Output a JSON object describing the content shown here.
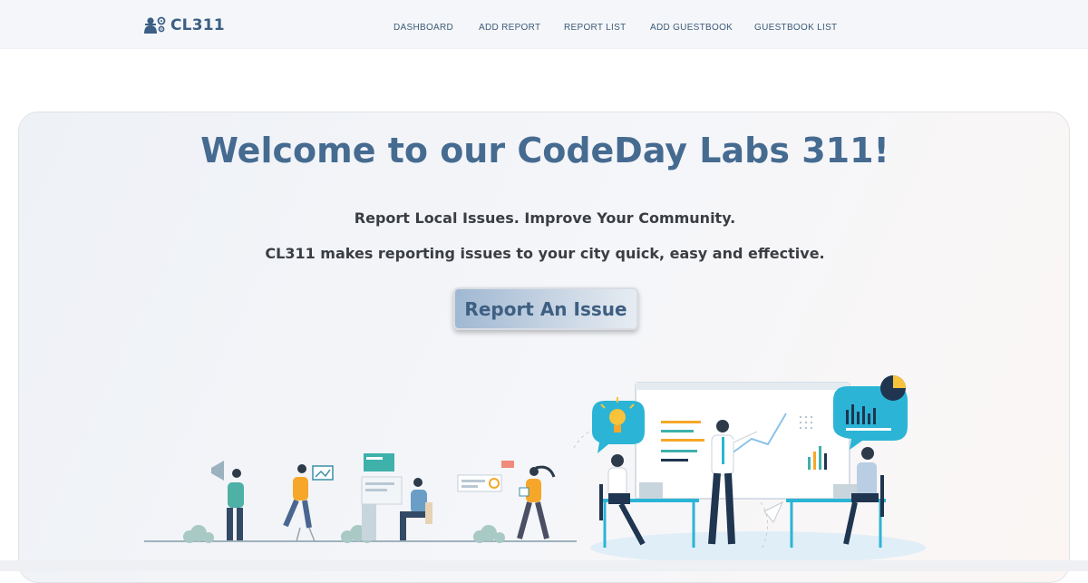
{
  "brand": {
    "name": "CL311",
    "icon": "people-gear-icon"
  },
  "nav": {
    "items": [
      {
        "label": "DASHBOARD",
        "key": "dashboard"
      },
      {
        "label": "ADD REPORT",
        "key": "add-report"
      },
      {
        "label": "REPORT LIST",
        "key": "report-list"
      },
      {
        "label": "ADD GUESTBOOK",
        "key": "add-guestbook"
      },
      {
        "label": "GUESTBOOK LIST",
        "key": "guestbook-list"
      }
    ]
  },
  "hero": {
    "title": "Welcome to our CodeDay Labs 311!",
    "tagline_1": "Report Local Issues. Improve Your Community.",
    "tagline_2": "CL311 makes reporting issues to your city quick, easy and effective.",
    "cta_label": "Report An Issue",
    "illustration": "team-collaboration-illustration"
  },
  "colors": {
    "brand": "#3b5f85",
    "title": "#466b91",
    "accent_cyan": "#2bb4d6",
    "navy": "#1f3550",
    "orange": "#f6a72a"
  }
}
